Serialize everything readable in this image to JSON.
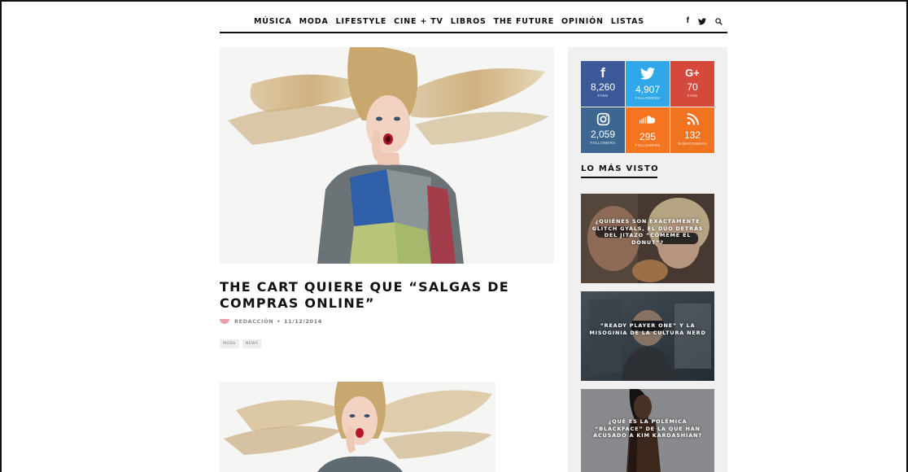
{
  "nav": {
    "items": [
      "MÚSICA",
      "MODA",
      "LIFESTYLE",
      "CINE + TV",
      "LIBROS",
      "THE FUTURE",
      "OPINIÓN",
      "LISTAS"
    ],
    "social_icons": [
      "facebook-icon",
      "twitter-icon",
      "search-icon"
    ]
  },
  "post": {
    "title": "THE CART QUIERE QUE “SALGAS DE COMPRAS ONLINE”",
    "author": "REDACCIÓN",
    "separator": "•",
    "date": "11/12/2014",
    "tags": [
      "MODA",
      "NEWS"
    ]
  },
  "social": [
    {
      "network": "facebook",
      "icon": "facebook-icon",
      "glyph": "f",
      "count": "8,260",
      "label": "FANS",
      "color": "#3b5998"
    },
    {
      "network": "twitter",
      "icon": "twitter-icon",
      "glyph": "🐦",
      "count": "4,907",
      "label": "FOLLOWERS",
      "color": "#2fa7e8"
    },
    {
      "network": "google-plus",
      "icon": "google-plus-icon",
      "glyph": "G+",
      "count": "70",
      "label": "FANS",
      "color": "#d4493b"
    },
    {
      "network": "instagram",
      "icon": "instagram-icon",
      "glyph": "◎",
      "count": "2,059",
      "label": "FOLLOWERS",
      "color": "#3d6791"
    },
    {
      "network": "soundcloud",
      "icon": "soundcloud-icon",
      "glyph": "☁",
      "count": "295",
      "label": "FOLLOWERS",
      "color": "#f5741f"
    },
    {
      "network": "rss",
      "icon": "rss-icon",
      "glyph": "◟",
      "count": "132",
      "label": "SUBSCRIBERS",
      "color": "#f07320"
    }
  ],
  "sidebar": {
    "most_viewed_title": "LO MÁS VISTO",
    "popular": [
      "¿QUIÉNES SON EXACTAMENTE GLITCH GYALS, EL DÚO DETRÁS DEL JITAZO “CÓMEME EL DONUT”?",
      "“READY PLAYER ONE” Y LA MISOGINIA DE LA CULTURA NERD",
      "¿QUÉ ES LA POLÉMICA “BLACKFACE” DE LA QUE HAN ACUSADO A KIM KARDASHIAN?"
    ]
  }
}
